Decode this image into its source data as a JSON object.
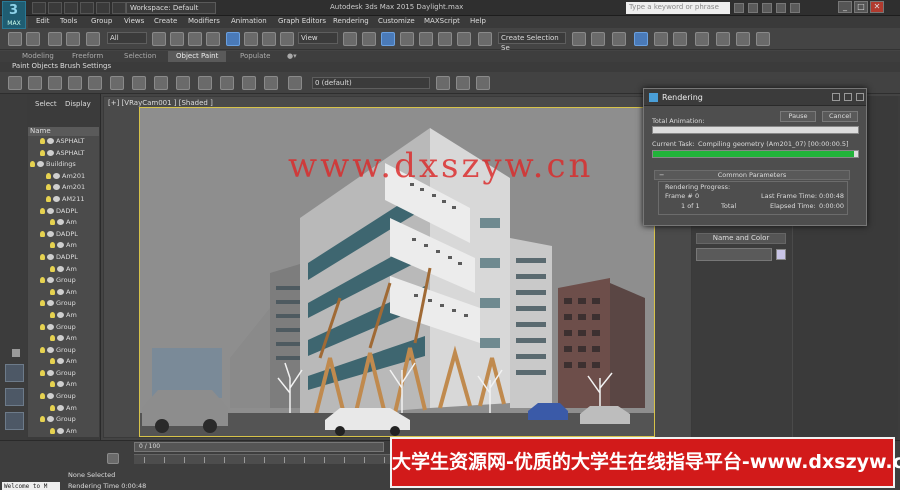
{
  "titlebar": {
    "workspace_label": "Workspace: Default",
    "app_title": "Autodesk 3ds Max 2015     Daylight.max",
    "search_placeholder": "Type a keyword or phrase",
    "logo_text": "MAX"
  },
  "menu": [
    "Edit",
    "Tools",
    "Group",
    "Views",
    "Create",
    "Modifiers",
    "Animation",
    "Graph Editors",
    "Rendering",
    "Customize",
    "MAXScript",
    "Help"
  ],
  "main_toolbar": {
    "selection_filter": "All",
    "reference_coord": "View",
    "named_selection": "Create Selection Se"
  },
  "ribbon": {
    "tabs": [
      "Modeling",
      "Freeform",
      "Selection",
      "Object Paint",
      "Populate"
    ],
    "active_tab": "Object Paint",
    "subtabs": [
      "Paint Objects",
      "Brush Settings"
    ],
    "layer_dropdown": "0 (default)"
  },
  "scene_explorer": {
    "tabs": [
      "Select",
      "Display"
    ],
    "column_header": "Name",
    "rows": [
      "ASPHALT",
      "ASPHALT",
      "Buildings",
      "Am201",
      "Am201",
      "AM211",
      "DADPL",
      "Am",
      "DADPL",
      "Am",
      "DADPL",
      "Am",
      "Group",
      "Am",
      "Group",
      "Am",
      "Group",
      "Am",
      "Group",
      "Am",
      "Group",
      "Am",
      "Group",
      "Am",
      "Group",
      "Am"
    ]
  },
  "viewport": {
    "label": "[+] [VRayCam001 ] [Shaded ]"
  },
  "command_panel": {
    "rollout_title": "Name and Color",
    "swatch_color": "#c8c4e6"
  },
  "render_dialog": {
    "title": "Rendering",
    "pause_label": "Pause",
    "cancel_label": "Cancel",
    "total_animation_label": "Total Animation:",
    "total_progress": 0,
    "current_task_label": "Current Task:",
    "current_task_value": "Compiling geometry (Am201_07) [00:00:00.5]",
    "current_progress": 0.98,
    "section_title": "Common Parameters",
    "rendering_progress_label": "Rendering Progress:",
    "frame_label": "Frame #",
    "frame_value": "0",
    "of_label": "1 of 1",
    "total_label": "Total",
    "last_frame_time_label": "Last Frame Time:",
    "last_frame_time_value": "0:00:48",
    "elapsed_time_label": "Elapsed Time:",
    "elapsed_time_value": "0:00:00"
  },
  "status": {
    "time_slider": "0 / 100",
    "selection_text": "None Selected",
    "render_time": "Rendering Time  0:00:48",
    "welcome": "Welcome to M"
  },
  "watermark": "www.dxszyw.cn",
  "banner": "大学生资源网-优质的大学生在线指导平台-www.dxszyw.cn"
}
